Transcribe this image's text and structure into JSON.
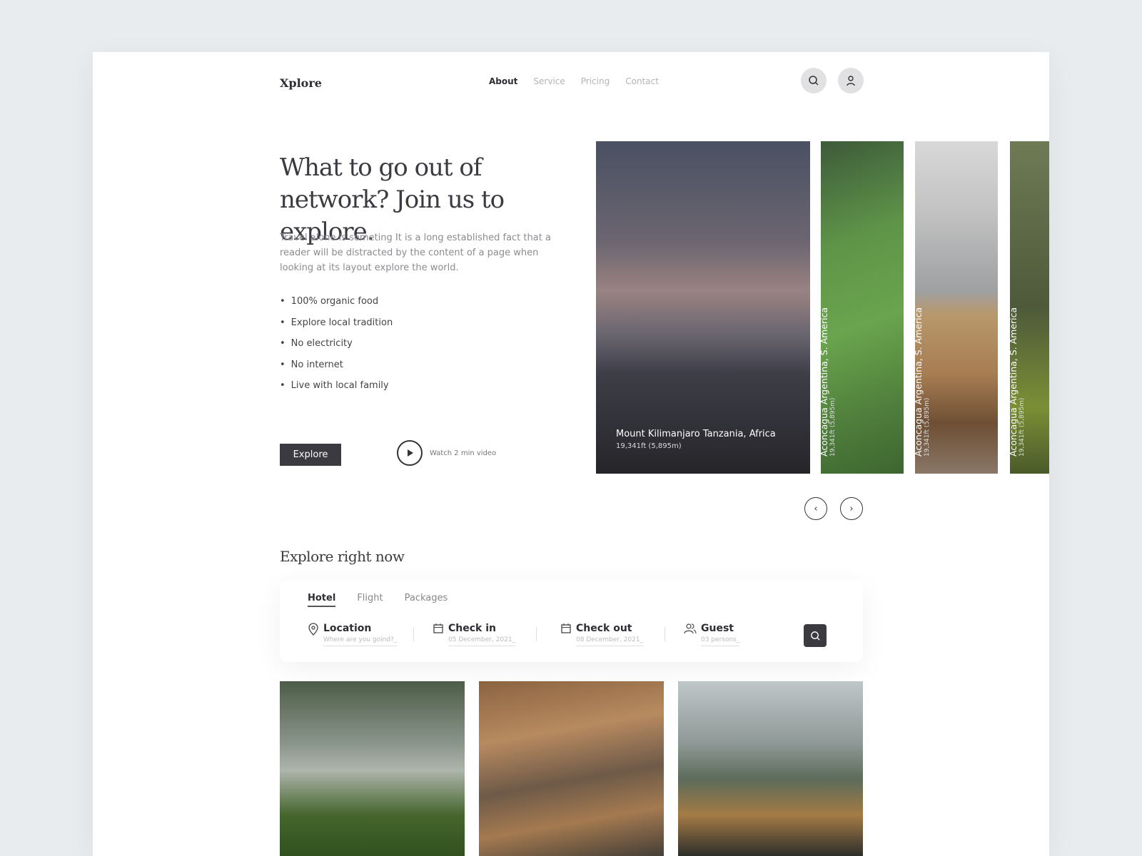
{
  "header": {
    "logo": "Xplore",
    "nav": [
      "About",
      "Service",
      "Pricing",
      "Contact"
    ],
    "active": "About"
  },
  "hero": {
    "title": "What to go out of network? Join us to explore.",
    "description": "Travel alone is someting It is a long established fact that a reader will be distracted by the content of a page when looking at its layout explore the world.",
    "features": [
      "100% organic food",
      "Explore local tradition",
      "No electricity",
      "No internet",
      "Live with local family"
    ],
    "cta": "Explore",
    "video_label": "Watch 2 min video"
  },
  "slides": [
    {
      "name": "Mount Kilimanjaro Tanzania, Africa",
      "height": "19,341ft (5,895m)"
    },
    {
      "name": "Aconcagua Argentina, S. America",
      "height": "19,341ft (5,895m)"
    },
    {
      "name": "Aconcagua Argentina, S. America",
      "height": "19,341ft (5,895m)"
    },
    {
      "name": "Aconcagua Argentina, S. America",
      "height": "19,341ft (5,895m)"
    }
  ],
  "explore": {
    "title": "Explore right now",
    "tabs": [
      "Hotel",
      "Flight",
      "Packages"
    ],
    "active_tab": "Hotel",
    "fields": [
      {
        "label": "Location",
        "placeholder": "Where are you goind?_",
        "icon": "location-pin-icon"
      },
      {
        "label": "Check in",
        "placeholder": "05 December, 2021_",
        "icon": "calendar-icon"
      },
      {
        "label": "Check out",
        "placeholder": "08 December, 2021_",
        "icon": "calendar-icon"
      },
      {
        "label": "Guest",
        "placeholder": "03 persons_",
        "icon": "users-icon"
      }
    ]
  }
}
